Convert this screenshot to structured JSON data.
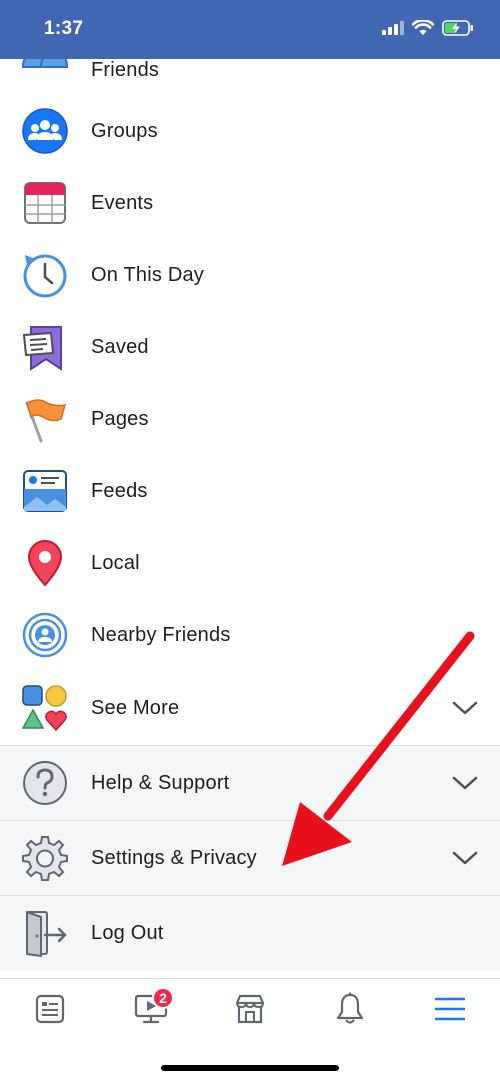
{
  "status_bar": {
    "time": "1:37",
    "color": "#4267b2"
  },
  "menu": {
    "items": [
      {
        "label": "Friends",
        "icon": "friends-icon"
      },
      {
        "label": "Groups",
        "icon": "groups-icon"
      },
      {
        "label": "Events",
        "icon": "calendar-icon"
      },
      {
        "label": "On This Day",
        "icon": "clock-history-icon"
      },
      {
        "label": "Saved",
        "icon": "bookmark-icon"
      },
      {
        "label": "Pages",
        "icon": "flag-icon"
      },
      {
        "label": "Feeds",
        "icon": "feeds-icon"
      },
      {
        "label": "Local",
        "icon": "map-pin-icon"
      },
      {
        "label": "Nearby Friends",
        "icon": "nearby-icon"
      },
      {
        "label": "See More",
        "icon": "shapes-icon"
      }
    ],
    "sections": [
      {
        "label": "Help & Support",
        "icon": "question-icon"
      },
      {
        "label": "Settings & Privacy",
        "icon": "gear-icon"
      },
      {
        "label": "Log Out",
        "icon": "logout-door-icon"
      }
    ]
  },
  "tab_bar": {
    "tabs": [
      {
        "name": "news-feed",
        "icon": "news-feed-icon"
      },
      {
        "name": "watch",
        "icon": "watch-icon",
        "badge": "2"
      },
      {
        "name": "marketplace",
        "icon": "marketplace-icon"
      },
      {
        "name": "notifications",
        "icon": "bell-icon"
      },
      {
        "name": "menu",
        "icon": "hamburger-icon",
        "active": true
      }
    ],
    "active_color": "#1877f2"
  },
  "annotation": {
    "arrow_color": "#e8101c"
  }
}
